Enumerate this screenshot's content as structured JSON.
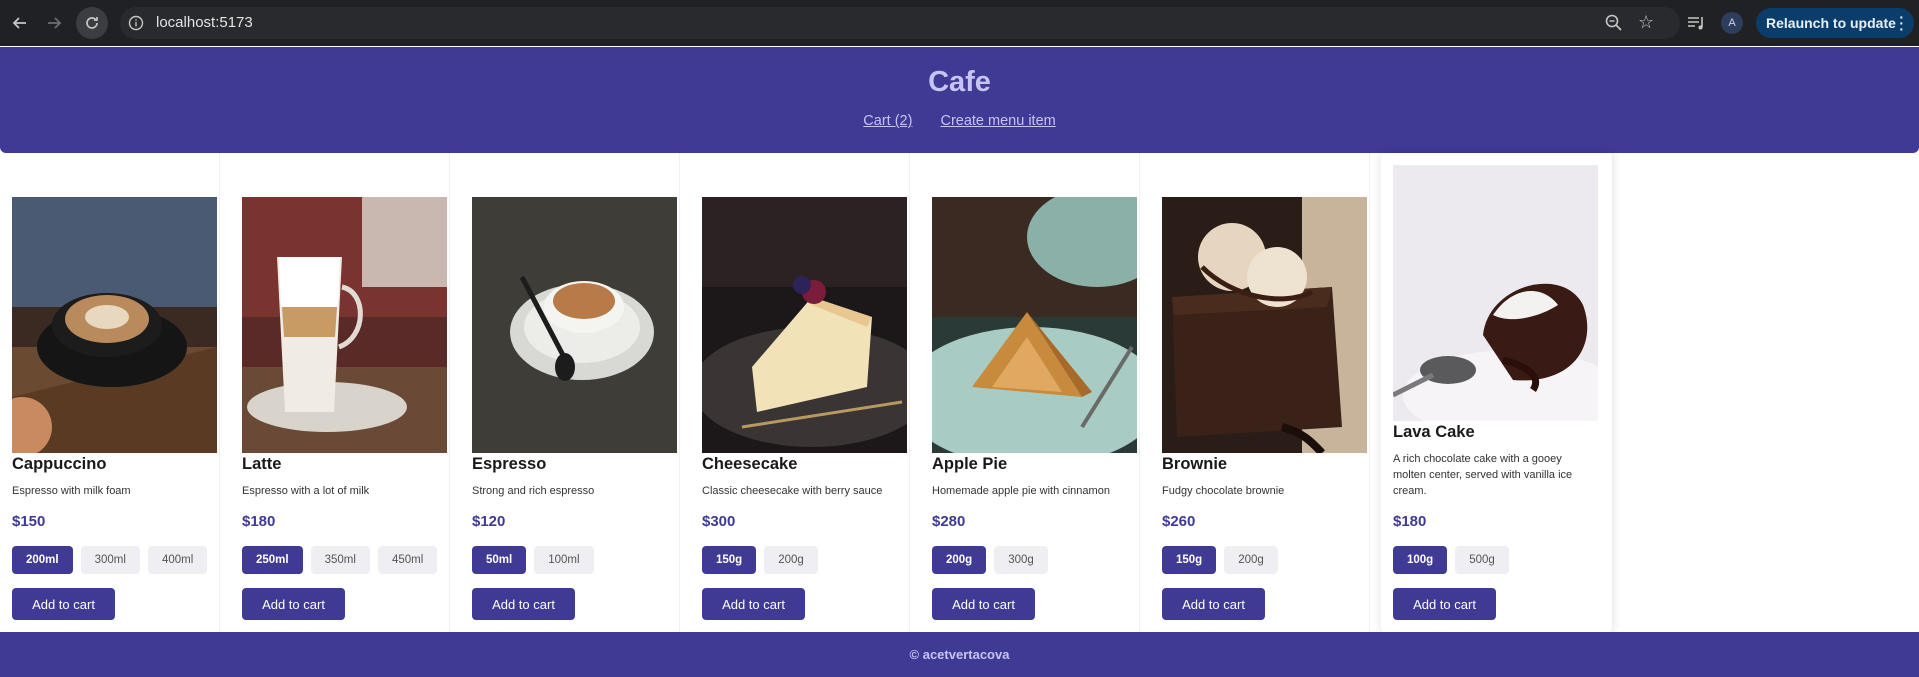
{
  "browser": {
    "url": "localhost:5173",
    "profile_initial": "A",
    "relaunch_label": "Relaunch to update"
  },
  "header": {
    "title": "Cafe",
    "cart_link": "Cart (2)",
    "create_link": "Create menu item"
  },
  "items": [
    {
      "name": "Cappuccino",
      "desc": "Espresso with milk foam",
      "price": "$150",
      "sizes": [
        "200ml",
        "300ml",
        "400ml"
      ],
      "selected": 0,
      "add": "Add to cart",
      "photo": "coffee cup"
    },
    {
      "name": "Latte",
      "desc": "Espresso with a lot of milk",
      "price": "$180",
      "sizes": [
        "250ml",
        "350ml",
        "450ml"
      ],
      "selected": 0,
      "add": "Add to cart",
      "photo": "latte glass"
    },
    {
      "name": "Espresso",
      "desc": "Strong and rich espresso",
      "price": "$120",
      "sizes": [
        "50ml",
        "100ml"
      ],
      "selected": 0,
      "add": "Add to cart",
      "photo": "espresso cup"
    },
    {
      "name": "Cheesecake",
      "desc": "Classic cheesecake with berry sauce",
      "price": "$300",
      "sizes": [
        "150g",
        "200g"
      ],
      "selected": 0,
      "add": "Add to cart",
      "photo": "cheesecake slice"
    },
    {
      "name": "Apple Pie",
      "desc": "Homemade apple pie with cinnamon",
      "price": "$280",
      "sizes": [
        "200g",
        "300g"
      ],
      "selected": 0,
      "add": "Add to cart",
      "photo": "apple pie slice"
    },
    {
      "name": "Brownie",
      "desc": "Fudgy chocolate brownie",
      "price": "$260",
      "sizes": [
        "150g",
        "200g"
      ],
      "selected": 0,
      "add": "Add to cart",
      "photo": "brownie with ice cream"
    },
    {
      "name": "Lava Cake",
      "desc": "A rich chocolate cake with a gooey molten center, served with vanilla ice cream.",
      "price": "$180",
      "sizes": [
        "100g",
        "500g"
      ],
      "selected": 0,
      "add": "Add to cart",
      "photo": "lava cake"
    }
  ],
  "footer": {
    "text": "© acetvertacova"
  },
  "colors": {
    "brand": "#3f3a94",
    "brand_text": "#c8c3f5"
  }
}
